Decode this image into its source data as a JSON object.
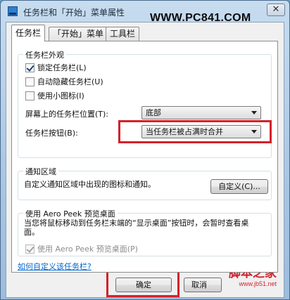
{
  "window": {
    "title": "任务栏和「开始」菜单属性",
    "close_glyph": "✕"
  },
  "watermark_top": "WWW.PC841.COM",
  "tabs": [
    {
      "label": "任务栏",
      "active": true
    },
    {
      "label": "「开始」菜单",
      "active": false
    },
    {
      "label": "工具栏",
      "active": false
    }
  ],
  "appearance": {
    "title": "任务栏外观",
    "options": [
      {
        "label": "锁定任务栏(L)",
        "checked": true
      },
      {
        "label": "自动隐藏任务栏(U)",
        "checked": false
      },
      {
        "label": "使用小图标(I)",
        "checked": false
      }
    ],
    "position_label": "屏幕上的任务栏位置(T):",
    "position_value": "底部",
    "buttons_label": "任务栏按钮(B):",
    "buttons_value": "当任务栏被占满时合并"
  },
  "notification": {
    "title": "通知区域",
    "description": "自定义通知区域中出现的图标和通知。",
    "customize_label": "自定义(C)..."
  },
  "aero_peek": {
    "title": "使用 Aero Peek 预览桌面",
    "description": "当您将鼠标移动到任务栏末端的“显示桌面”按钮时，会暂时查看桌面。",
    "option_label": "使用 Aero Peek 预览桌面(P)",
    "option_checked": true,
    "option_disabled": true
  },
  "help_link": "如何自定义该任务栏?",
  "footer": {
    "ok_label": "确定",
    "cancel_partial": "取消"
  },
  "site_logo": {
    "name": "脚本之家",
    "url": "www.jb51.net"
  },
  "colors": {
    "highlight": "#d4212a",
    "link": "#0066cc",
    "logo": "#d51f2a"
  }
}
